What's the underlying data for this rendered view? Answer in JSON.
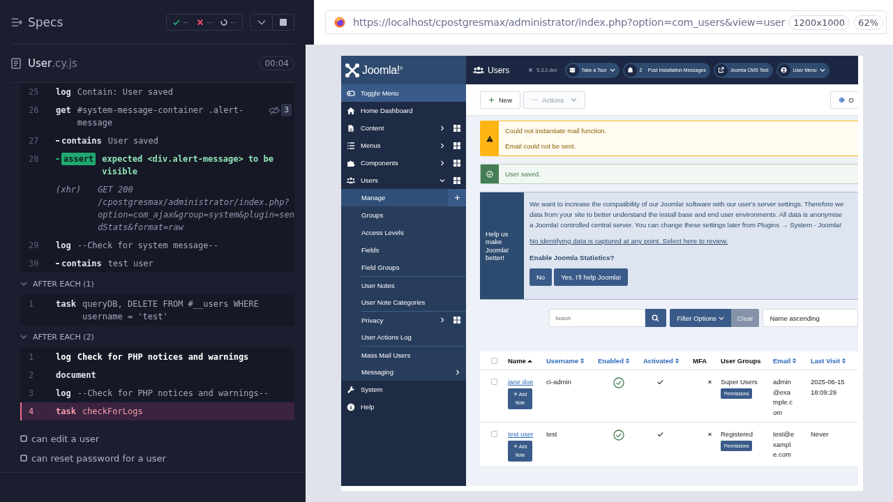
{
  "runner": {
    "title": "Specs",
    "stats": [
      {
        "kind": "passed",
        "count": "--"
      },
      {
        "kind": "failed",
        "count": "--"
      },
      {
        "kind": "pending",
        "count": "--"
      }
    ],
    "spec": {
      "name": "User",
      "extension": ".cy.js",
      "duration": "00:04"
    },
    "sections": [
      {
        "commands": [
          {
            "number": "25",
            "child": false,
            "command": "log",
            "message": "Contain: User saved",
            "kind": "command",
            "strong": false
          },
          {
            "number": "26",
            "child": false,
            "command": "get",
            "message": "#system-message-container .alert-message",
            "kind": "command",
            "strong": false,
            "pinned_count": "3"
          },
          {
            "number": "27",
            "child": true,
            "command": "contains",
            "message": "User saved",
            "kind": "command",
            "strong": false
          },
          {
            "number": "28",
            "child": true,
            "command": "assert",
            "message": "expected **<div.alert-message>** to be visible",
            "kind": "assert",
            "strong": false
          },
          {
            "child": false,
            "command": "(xhr)",
            "message": "GET 200 /cpostgresmax/administrator/index.php?option=com_ajax&group=system&plugin=sendStats&format=raw",
            "kind": "xhr",
            "strong": false
          },
          {
            "number": "29",
            "child": false,
            "command": "log",
            "message": "--Check for system message--",
            "kind": "command",
            "strong": false
          },
          {
            "number": "30",
            "child": true,
            "command": "contains",
            "message": "test user",
            "kind": "command",
            "strong": false
          }
        ]
      },
      {
        "heading": "AFTER EACH (1)",
        "expanded": true,
        "commands": [
          {
            "number": "1",
            "child": false,
            "command": "task",
            "message": "queryDB, DELETE FROM #__users WHERE username = 'test'",
            "kind": "command",
            "strong": false
          }
        ]
      },
      {
        "heading": "AFTER EACH (2)",
        "expanded": true,
        "commands": [
          {
            "number": "1",
            "child": false,
            "command": "log",
            "message": "Check for PHP notices and warnings",
            "kind": "command",
            "strong": true
          },
          {
            "number": "2",
            "child": false,
            "command": "document",
            "kind": "command",
            "strong": false
          },
          {
            "number": "3",
            "child": false,
            "command": "log",
            "message": "--Check for PHP notices and warnings--",
            "kind": "command",
            "strong": false
          },
          {
            "number": "4",
            "child": false,
            "command": "task",
            "message": "checkForLogs",
            "kind": "error",
            "strong": false
          }
        ]
      }
    ],
    "tests": [
      {
        "title": "can edit a user"
      },
      {
        "title": "can reset password for a user"
      }
    ]
  },
  "browser": {
    "url": "https://localhost/cpostgresmax/administrator/index.php?option=com_users&view=user",
    "viewport": "1200x1000",
    "scale": "62%"
  },
  "joomla": {
    "brand": "Joomla!$^{®}$",
    "page_title": "Users",
    "version": "5.3.2-dev",
    "header_buttons": [
      {
        "label": "Take a Tour",
        "dropdown": true
      },
      {
        "label": "Post Installation Messages",
        "count": "2",
        "dropdown": false
      },
      {
        "label": "Joomla CMS Test",
        "dropdown": false
      },
      {
        "label": "User Menu",
        "dropdown": true
      }
    ],
    "sidebar": [
      {
        "label": "Toggle Menu",
        "kind": "toggle"
      },
      {
        "label": "Home Dashboard",
        "kind": "link"
      },
      {
        "label": "Content",
        "kind": "link",
        "expanded": false,
        "dashboard": true
      },
      {
        "label": "Menus",
        "kind": "link",
        "expanded": false,
        "dashboard": true
      },
      {
        "label": "Components",
        "kind": "link",
        "expanded": false,
        "dashboard": true
      },
      {
        "label": "Users",
        "kind": "link",
        "expanded": true,
        "dashboard": true,
        "children": [
          {
            "label": "Manage",
            "selected": true,
            "separator": false,
            "add_button": true
          },
          {
            "label": "Groups",
            "selected": false,
            "separator": false
          },
          {
            "label": "Access Levels",
            "selected": false,
            "separator": false
          },
          {
            "label": "Fields",
            "selected": false,
            "separator": false
          },
          {
            "label": "Field Groups",
            "selected": false,
            "separator": false
          },
          {
            "label": "User Notes",
            "selected": false,
            "separator": true
          },
          {
            "label": "User Note Categories",
            "selected": false,
            "separator": false
          },
          {
            "label": "Privacy",
            "selected": false,
            "separator": true,
            "expanded": false,
            "dashboard": true
          },
          {
            "label": "User Actions Log",
            "selected": false,
            "separator": false
          },
          {
            "label": "Mass Mail Users",
            "selected": false,
            "separator": true
          },
          {
            "label": "Messaging",
            "selected": false,
            "separator": false,
            "expanded": false
          }
        ]
      },
      {
        "label": "System",
        "kind": "link"
      },
      {
        "label": "Help",
        "kind": "link"
      }
    ],
    "toolbar": [
      {
        "label": "New",
        "kind": "new",
        "disabled": false
      },
      {
        "label": "Actions",
        "kind": "actions",
        "disabled": true
      },
      {
        "label": "O",
        "kind": "options",
        "disabled": false
      }
    ],
    "messages": [
      {
        "kind": "warning",
        "lines": [
          "Could not instantiate mail function.",
          "Email could not be sent."
        ]
      },
      {
        "kind": "success",
        "lines": [
          "User saved."
        ]
      }
    ],
    "stats_prompt": {
      "heading": "Help us make Joomla! better!",
      "lines": [
        "We want to increase the compatibility of our Joomla! software with our user's server settings. Therefore we",
        "data from your site to better understand the install base and end user environments. All data is anonymise",
        "a Joomla! controlled central server. You can change these settings later from Plugins → System - Joomla!"
      ],
      "link": "No identifying data is captured at any point. Select here to review.",
      "question": "Enable Joomla Statistics?",
      "buttons": [
        "No",
        "Yes, I'll help Joomla!"
      ]
    },
    "filters": {
      "search_placeholder": "Search",
      "filter_button": "Filter Options",
      "clear_button": "Clear",
      "ordering": "Name ascending"
    },
    "table": {
      "all_selected": false,
      "columns": [
        {
          "label": "Name",
          "sortable": true,
          "sorted": true
        },
        {
          "label": "Username",
          "sortable": true,
          "sorted": false
        },
        {
          "label": "Enabled",
          "sortable": true,
          "sorted": false
        },
        {
          "label": "Activated",
          "sortable": true,
          "sorted": false
        },
        {
          "label": "MFA",
          "sortable": false,
          "sorted": false
        },
        {
          "label": "User Groups",
          "sortable": false,
          "sorted": false
        },
        {
          "label": "Email",
          "sortable": true,
          "sorted": false
        },
        {
          "label": "Last Visit",
          "sortable": true,
          "sorted": false
        }
      ],
      "rows": [
        {
          "selected": false,
          "name": "jane doe",
          "note_button": "Add Note",
          "username": "ci-admin",
          "enabled": true,
          "activated": true,
          "mfa": false,
          "group": "Super Users",
          "permissions_button": "Permissions",
          "email": "admin@example.com",
          "last_visit": "2025-06-15 18:09:29"
        },
        {
          "selected": false,
          "name": "test user",
          "note_button": "Add Note",
          "username": "test",
          "enabled": true,
          "activated": true,
          "mfa": false,
          "group": "Registered",
          "permissions_button": "Permissions",
          "email": "test@example.com",
          "last_visit": "Never"
        }
      ]
    }
  }
}
